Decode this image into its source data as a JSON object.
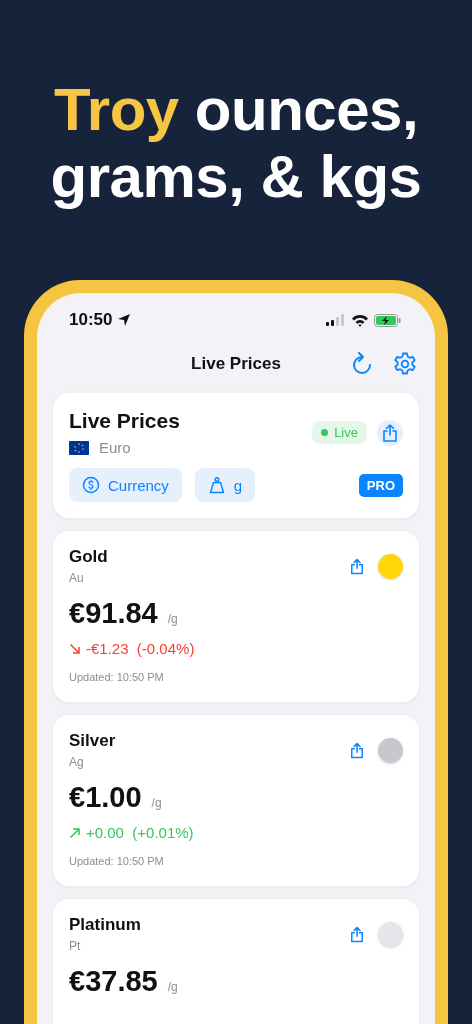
{
  "headline": "**Troy** ounces, grams, & kgs",
  "status_bar": {
    "time": "10:50"
  },
  "nav": {
    "title": "Live Prices"
  },
  "summary": {
    "title": "Live Prices",
    "currency": "Euro",
    "live_badge": "Live",
    "currency_button": "Currency",
    "unit_button": "g",
    "pro_badge": "PRO"
  },
  "metals": [
    {
      "name": "Gold",
      "symbol": "Au",
      "price": "€91.84",
      "unit": "/g",
      "kind": "down",
      "change": "-€1.23  (-0.04%)",
      "updated": "Updated: 10:50 PM",
      "color": "#ffd60a"
    },
    {
      "name": "Silver",
      "symbol": "Ag",
      "price": "€1.00",
      "unit": "/g",
      "kind": "up",
      "change": "+0.00  (+0.01%)",
      "updated": "Updated: 10:50 PM",
      "color": "#c7c7cc"
    },
    {
      "name": "Platinum",
      "symbol": "Pt",
      "price": "€37.85",
      "unit": "/g",
      "color": "#e5e5ea"
    }
  ]
}
